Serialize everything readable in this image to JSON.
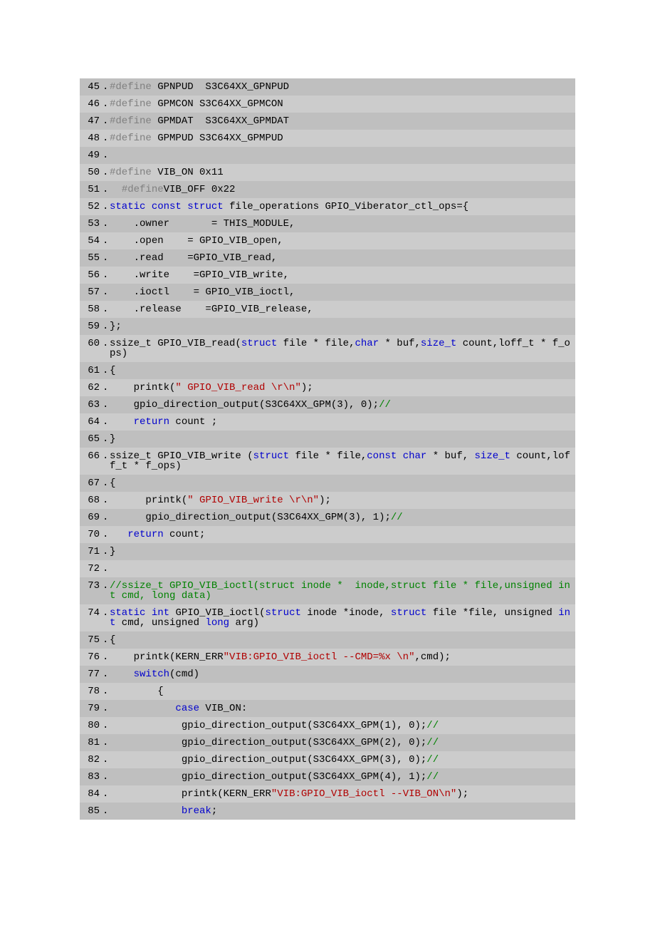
{
  "startLine": 45,
  "lines": [
    {
      "segments": [
        {
          "text": "#define",
          "class": "pp"
        },
        {
          "text": " GPNPUD  S3C64XX_GPNPUD  "
        }
      ]
    },
    {
      "segments": [
        {
          "text": "#define",
          "class": "pp"
        },
        {
          "text": " GPMCON S3C64XX_GPMCON  "
        }
      ]
    },
    {
      "segments": [
        {
          "text": "#define",
          "class": "pp"
        },
        {
          "text": " GPMDAT  S3C64XX_GPMDAT  "
        }
      ]
    },
    {
      "segments": [
        {
          "text": "#define",
          "class": "pp"
        },
        {
          "text": " GPMPUD S3C64XX_GPMPUD  "
        }
      ]
    },
    {
      "segments": [
        {
          "text": "  "
        }
      ]
    },
    {
      "segments": [
        {
          "text": "#define",
          "class": "pp"
        },
        {
          "text": " VIB_ON 0x11  "
        }
      ]
    },
    {
      "segments": [
        {
          "text": "  #define",
          "class": "pp"
        },
        {
          "text": "VIB_OFF 0x22  "
        }
      ]
    },
    {
      "segments": [
        {
          "text": "static",
          "class": "kw"
        },
        {
          "text": " "
        },
        {
          "text": "const",
          "class": "kw"
        },
        {
          "text": " "
        },
        {
          "text": "struct",
          "class": "kw"
        },
        {
          "text": " file_operations GPIO_Viberator_ctl_ops={  "
        }
      ]
    },
    {
      "segments": [
        {
          "text": "    .owner       = THIS_MODULE,  "
        }
      ]
    },
    {
      "segments": [
        {
          "text": "    .open    = GPIO_VIB_open,  "
        }
      ]
    },
    {
      "segments": [
        {
          "text": "    .read    =GPIO_VIB_read,  "
        }
      ]
    },
    {
      "segments": [
        {
          "text": "    .write    =GPIO_VIB_write,  "
        }
      ]
    },
    {
      "segments": [
        {
          "text": "    .ioctl    = GPIO_VIB_ioctl,  "
        }
      ]
    },
    {
      "segments": [
        {
          "text": "    .release    =GPIO_VIB_release,  "
        }
      ]
    },
    {
      "segments": [
        {
          "text": "};  "
        }
      ]
    },
    {
      "segments": [
        {
          "text": "ssize_t GPIO_VIB_read("
        },
        {
          "text": "struct",
          "class": "kw"
        },
        {
          "text": " file * file,"
        },
        {
          "text": "char",
          "class": "kw"
        },
        {
          "text": " * buf,"
        },
        {
          "text": "size_t",
          "class": "kw"
        },
        {
          "text": " count,loff_t * f_ops)  "
        }
      ]
    },
    {
      "segments": [
        {
          "text": "{   "
        }
      ]
    },
    {
      "segments": [
        {
          "text": "    printk("
        },
        {
          "text": "\" GPIO_VIB_read \\r\\n\"",
          "class": "str"
        },
        {
          "text": ");  "
        }
      ]
    },
    {
      "segments": [
        {
          "text": "    gpio_direction_output(S3C64XX_GPM(3), 0);"
        },
        {
          "text": "// ",
          "class": "cmt"
        }
      ]
    },
    {
      "segments": [
        {
          "text": "    "
        },
        {
          "text": "return",
          "class": "kw"
        },
        {
          "text": " count ;  "
        }
      ]
    },
    {
      "segments": [
        {
          "text": "}  "
        }
      ]
    },
    {
      "segments": [
        {
          "text": "ssize_t GPIO_VIB_write ("
        },
        {
          "text": "struct",
          "class": "kw"
        },
        {
          "text": " file * file,"
        },
        {
          "text": "const",
          "class": "kw"
        },
        {
          "text": " "
        },
        {
          "text": "char",
          "class": "kw"
        },
        {
          "text": " * buf, "
        },
        {
          "text": "size_t",
          "class": "kw"
        },
        {
          "text": " count,loff_t * f_ops)  "
        }
      ]
    },
    {
      "segments": [
        {
          "text": "{  "
        }
      ]
    },
    {
      "segments": [
        {
          "text": "      printk("
        },
        {
          "text": "\" GPIO_VIB_write \\r\\n\"",
          "class": "str"
        },
        {
          "text": ");  "
        }
      ]
    },
    {
      "segments": [
        {
          "text": "      gpio_direction_output(S3C64XX_GPM(3), 1);"
        },
        {
          "text": "// ",
          "class": "cmt"
        }
      ]
    },
    {
      "segments": [
        {
          "text": "   "
        },
        {
          "text": "return",
          "class": "kw"
        },
        {
          "text": " count;  "
        }
      ]
    },
    {
      "segments": [
        {
          "text": "}  "
        }
      ]
    },
    {
      "segments": [
        {
          "text": "  "
        }
      ]
    },
    {
      "segments": [
        {
          "text": "//ssize_t GPIO_VIB_ioctl(struct inode *  inode,struct file * file,unsigned int cmd, long data) ",
          "class": "cmt"
        }
      ]
    },
    {
      "segments": [
        {
          "text": "static",
          "class": "kw"
        },
        {
          "text": " "
        },
        {
          "text": "int",
          "class": "kw"
        },
        {
          "text": " GPIO_VIB_ioctl("
        },
        {
          "text": "struct",
          "class": "kw"
        },
        {
          "text": " inode *inode, "
        },
        {
          "text": "struct",
          "class": "kw"
        },
        {
          "text": " file *file, unsigned "
        },
        {
          "text": "int",
          "class": "kw"
        },
        {
          "text": " cmd, unsigned "
        },
        {
          "text": "long",
          "class": "kw"
        },
        {
          "text": " arg)  "
        }
      ]
    },
    {
      "segments": [
        {
          "text": "{  "
        }
      ]
    },
    {
      "segments": [
        {
          "text": "    printk(KERN_ERR"
        },
        {
          "text": "\"VIB:GPIO_VIB_ioctl --CMD=%x \\n\"",
          "class": "str"
        },
        {
          "text": ",cmd);  "
        }
      ]
    },
    {
      "segments": [
        {
          "text": "    "
        },
        {
          "text": "switch",
          "class": "kw"
        },
        {
          "text": "(cmd)  "
        }
      ]
    },
    {
      "segments": [
        {
          "text": "        {  "
        }
      ]
    },
    {
      "segments": [
        {
          "text": "           "
        },
        {
          "text": "case",
          "class": "kw"
        },
        {
          "text": " VIB_ON:  "
        }
      ]
    },
    {
      "segments": [
        {
          "text": "            gpio_direction_output(S3C64XX_GPM(1), 0);"
        },
        {
          "text": "// ",
          "class": "cmt"
        }
      ]
    },
    {
      "segments": [
        {
          "text": "            gpio_direction_output(S3C64XX_GPM(2), 0);"
        },
        {
          "text": "// ",
          "class": "cmt"
        }
      ]
    },
    {
      "segments": [
        {
          "text": "            gpio_direction_output(S3C64XX_GPM(3), 0);"
        },
        {
          "text": "// ",
          "class": "cmt"
        }
      ]
    },
    {
      "segments": [
        {
          "text": "            gpio_direction_output(S3C64XX_GPM(4), 1);"
        },
        {
          "text": "// ",
          "class": "cmt"
        }
      ]
    },
    {
      "segments": [
        {
          "text": "            printk(KERN_ERR"
        },
        {
          "text": "\"VIB:GPIO_VIB_ioctl --VIB_ON\\n\"",
          "class": "str"
        },
        {
          "text": ");  "
        }
      ]
    },
    {
      "segments": [
        {
          "text": "            "
        },
        {
          "text": "break",
          "class": "kw"
        },
        {
          "text": ";  "
        }
      ]
    }
  ]
}
